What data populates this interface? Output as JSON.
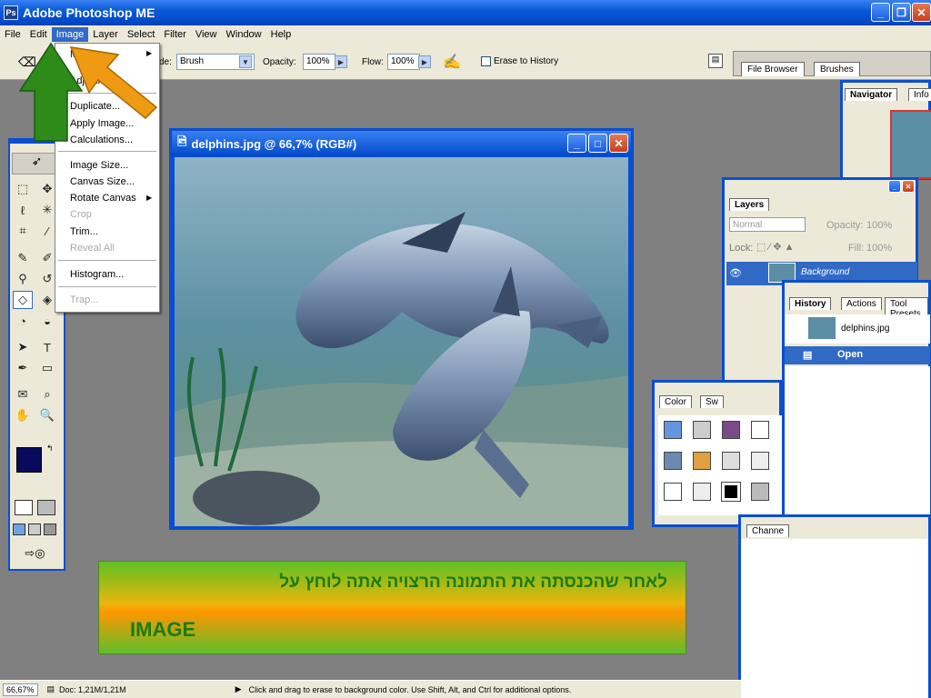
{
  "app": {
    "title": "Adobe Photoshop ME"
  },
  "menubar": [
    "File",
    "Edit",
    "Image",
    "Layer",
    "Select",
    "Filter",
    "View",
    "Window",
    "Help"
  ],
  "options_bar": {
    "mode_label": "de:",
    "mode_value": "Brush",
    "opacity_label": "Opacity:",
    "opacity_value": "100%",
    "flow_label": "Flow:",
    "flow_value": "100%",
    "erase_history_label": "Erase to History",
    "tabs": [
      "File Browser",
      "Brushes"
    ]
  },
  "image_menu": {
    "items": [
      {
        "label": "Mo",
        "submenu": true,
        "disabled": false
      },
      {
        "label": "Adjustme",
        "submenu": true,
        "disabled": false
      },
      {
        "sep": true
      },
      {
        "label": "Duplicate...",
        "disabled": false
      },
      {
        "label": "Apply Image...",
        "disabled": false
      },
      {
        "label": "Calculations...",
        "disabled": false
      },
      {
        "sep": true
      },
      {
        "label": "Image Size...",
        "disabled": false
      },
      {
        "label": "Canvas Size...",
        "disabled": false
      },
      {
        "label": "Rotate Canvas",
        "submenu": true,
        "disabled": false
      },
      {
        "label": "Crop",
        "disabled": true
      },
      {
        "label": "Trim...",
        "disabled": false
      },
      {
        "label": "Reveal All",
        "disabled": true
      },
      {
        "sep": true
      },
      {
        "label": "Histogram...",
        "disabled": false
      },
      {
        "sep": true
      },
      {
        "label": "Trap...",
        "disabled": true
      }
    ]
  },
  "image_window": {
    "title": "delphins.jpg @ 66,7% (RGB#)"
  },
  "navigator": {
    "tabs": [
      "Navigator",
      "Info"
    ]
  },
  "layers": {
    "tab": "Layers",
    "blend_mode": "Normal",
    "opacity_label": "Opacity:",
    "opacity_value": "100%",
    "lock_label": "Lock:",
    "fill_label": "Fill:",
    "fill_value": "100%",
    "layer_name": "Background"
  },
  "history": {
    "tabs": [
      "History",
      "Actions",
      "Tool Presets"
    ],
    "snapshot": "delphins.jpg",
    "state": "Open"
  },
  "swatches": {
    "tabs": [
      "Color",
      "Sw"
    ]
  },
  "channels": {
    "tab": "Channe"
  },
  "status": {
    "zoom": "66,67%",
    "doc": "Doc: 1,21M/1,21M",
    "hint": "Click and drag to erase to background color. Use Shift, Alt, and Ctrl for additional options."
  },
  "caption": {
    "line1": "לאחר שהכנסתה את התמונה הרצויה אתה לוחץ על",
    "line2": "IMAGE"
  },
  "colors": {
    "xp_blue": "#0a4ed0",
    "arrow_green": "#2e8b1a",
    "arrow_orange": "#ee9a12",
    "caption_text": "#1a7a16"
  }
}
